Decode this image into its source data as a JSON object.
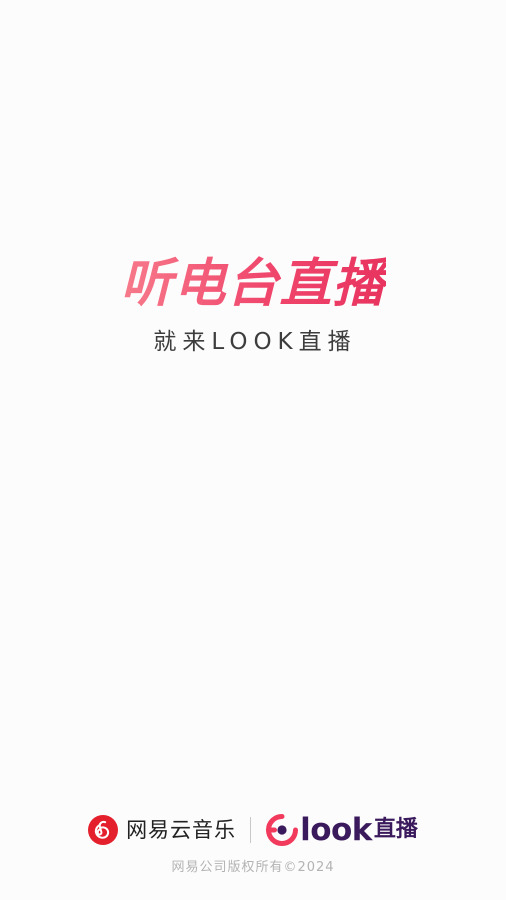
{
  "splash": {
    "headline": "听电台直播",
    "subline": "就来LOOK直播"
  },
  "footer": {
    "netease": {
      "icon": "netease-cloud-music-logo",
      "name": "网易云音乐"
    },
    "look": {
      "icon": "look-live-logo",
      "word": "look",
      "zh": "直播"
    },
    "copyright": "网易公司版权所有©2024"
  },
  "colors": {
    "background": "#fdfcfd",
    "headline_start": "#f77b8b",
    "headline_end": "#e8345f",
    "netease_red": "#e4202c",
    "look_red": "#f13a5c",
    "look_purple": "#3a1a5c",
    "copyright_gray": "#b3b3b3"
  }
}
